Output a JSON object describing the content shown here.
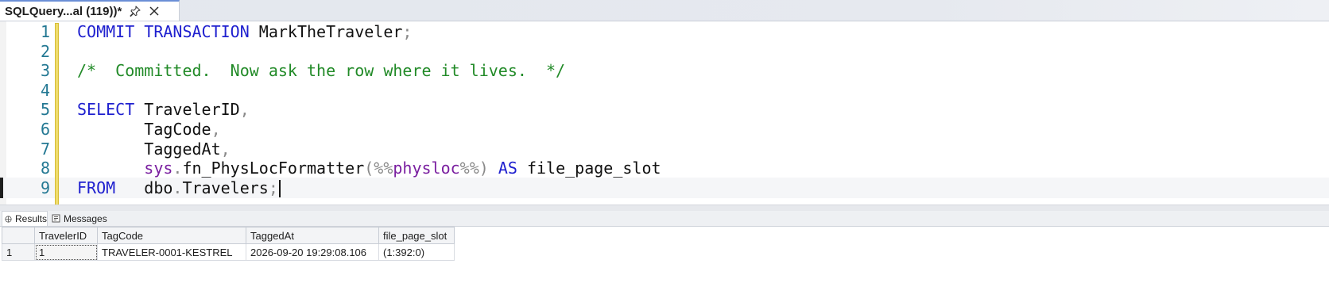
{
  "tab": {
    "title": "SQLQuery...al (119))*"
  },
  "icons": {
    "pin": "pin-icon",
    "close": "close-icon",
    "results": "grid-icon",
    "messages": "messages-icon"
  },
  "editor": {
    "lines": [
      {
        "num": "1",
        "tokens": [
          {
            "t": "COMMIT",
            "c": "kw"
          },
          {
            "t": " ",
            "c": "id"
          },
          {
            "t": "TRANSACTION",
            "c": "kw"
          },
          {
            "t": " MarkTheTraveler",
            "c": "id"
          },
          {
            "t": ";",
            "c": "op"
          }
        ]
      },
      {
        "num": "2",
        "tokens": []
      },
      {
        "num": "3",
        "tokens": [
          {
            "t": "/*  Committed.  Now ask the row where it lives.  */",
            "c": "cm"
          }
        ]
      },
      {
        "num": "4",
        "tokens": []
      },
      {
        "num": "5",
        "tokens": [
          {
            "t": "SELECT",
            "c": "kw"
          },
          {
            "t": " TravelerID",
            "c": "id"
          },
          {
            "t": ",",
            "c": "op"
          }
        ]
      },
      {
        "num": "6",
        "tokens": [
          {
            "t": "       TagCode",
            "c": "id"
          },
          {
            "t": ",",
            "c": "op"
          }
        ]
      },
      {
        "num": "7",
        "tokens": [
          {
            "t": "       TaggedAt",
            "c": "id"
          },
          {
            "t": ",",
            "c": "op"
          }
        ]
      },
      {
        "num": "8",
        "tokens": [
          {
            "t": "       ",
            "c": "id"
          },
          {
            "t": "sys",
            "c": "fn"
          },
          {
            "t": ".",
            "c": "op"
          },
          {
            "t": "fn_PhysLocFormatter",
            "c": "id"
          },
          {
            "t": "(%%",
            "c": "op"
          },
          {
            "t": "physloc",
            "c": "fn"
          },
          {
            "t": "%%)",
            "c": "op"
          },
          {
            "t": " ",
            "c": "id"
          },
          {
            "t": "AS",
            "c": "kw"
          },
          {
            "t": " file_page_slot",
            "c": "id"
          }
        ]
      },
      {
        "num": "9",
        "tokens": [
          {
            "t": "FROM",
            "c": "kw"
          },
          {
            "t": "   dbo",
            "c": "id"
          },
          {
            "t": ".",
            "c": "op"
          },
          {
            "t": "Travelers",
            "c": "id"
          },
          {
            "t": ";",
            "c": "op"
          }
        ]
      }
    ],
    "current_line": 9
  },
  "results_tabs": {
    "results_label": "Results",
    "messages_label": "Messages",
    "active": "Results"
  },
  "grid": {
    "columns": [
      "TravelerID",
      "TagCode",
      "TaggedAt",
      "file_page_slot"
    ],
    "rows": [
      {
        "rownum": "1",
        "cells": [
          "1",
          "TRAVELER-0001-KESTREL",
          "2026-09-20 19:29:08.106",
          "(1:392:0)"
        ]
      }
    ]
  },
  "colors": {
    "keyword": "#1f20cf",
    "comment": "#218a27",
    "line_number": "#237893",
    "system_function": "#7a1fa0",
    "change_bar": "#f0dc6c"
  }
}
